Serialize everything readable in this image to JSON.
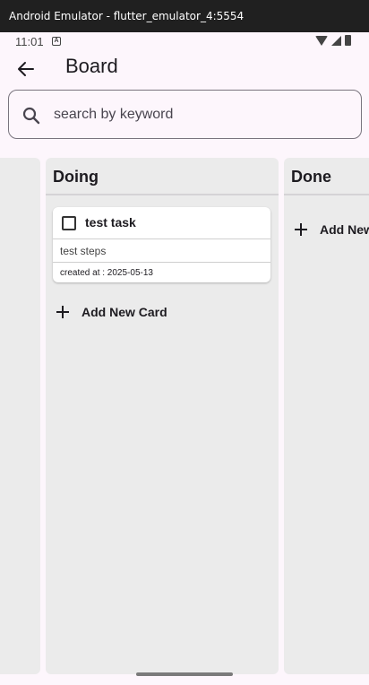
{
  "window": {
    "title": "Android Emulator - flutter_emulator_4:5554"
  },
  "statusbar": {
    "time": "11:01",
    "a_icon": "A"
  },
  "appbar": {
    "title": "Board"
  },
  "search": {
    "placeholder": "search by keyword",
    "value": ""
  },
  "columns": [
    {
      "title": ""
    },
    {
      "title": "Doing",
      "cards": [
        {
          "title": "test task",
          "steps": "test steps",
          "created": "created at : 2025-05-13"
        }
      ],
      "add_label": "Add New Card"
    },
    {
      "title": "Done",
      "add_label": "Add New"
    }
  ],
  "colors": {
    "background": "#fdf6fc",
    "column": "#ebebeb",
    "text": "#1d1b20"
  }
}
